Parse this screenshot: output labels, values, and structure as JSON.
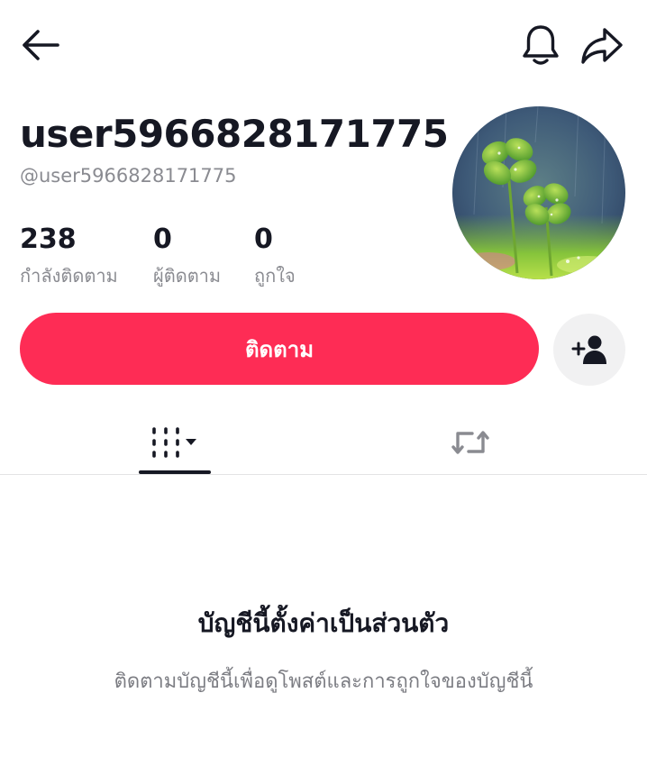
{
  "header": {
    "back_icon": "arrow-left-icon",
    "bell_icon": "bell-icon",
    "share_icon": "share-forward-icon"
  },
  "profile": {
    "display_name": "user5966828171775",
    "handle": "@user5966828171775",
    "avatar_description": "four-leaf-clover-photo"
  },
  "stats": [
    {
      "value": "238",
      "label": "กำลังติดตาม"
    },
    {
      "value": "0",
      "label": "ผู้ติดตาม"
    },
    {
      "value": "0",
      "label": "ถูกใจ"
    }
  ],
  "actions": {
    "follow_label": "ติดตาม",
    "add_friend_icon": "person-add-icon"
  },
  "tabs": [
    {
      "icon": "grid-dropdown-icon",
      "active": true
    },
    {
      "icon": "repost-icon",
      "active": false
    }
  ],
  "private_notice": {
    "title": "บัญชีนี้ตั้งค่าเป็นส่วนตัว",
    "subtitle": "ติดตามบัญชีนี้เพื่อดูโพสต์และการถูกใจของบัญชีนี้"
  },
  "colors": {
    "accent": "#fe2c55",
    "text_primary": "#161823",
    "text_secondary": "#8a8b91"
  }
}
